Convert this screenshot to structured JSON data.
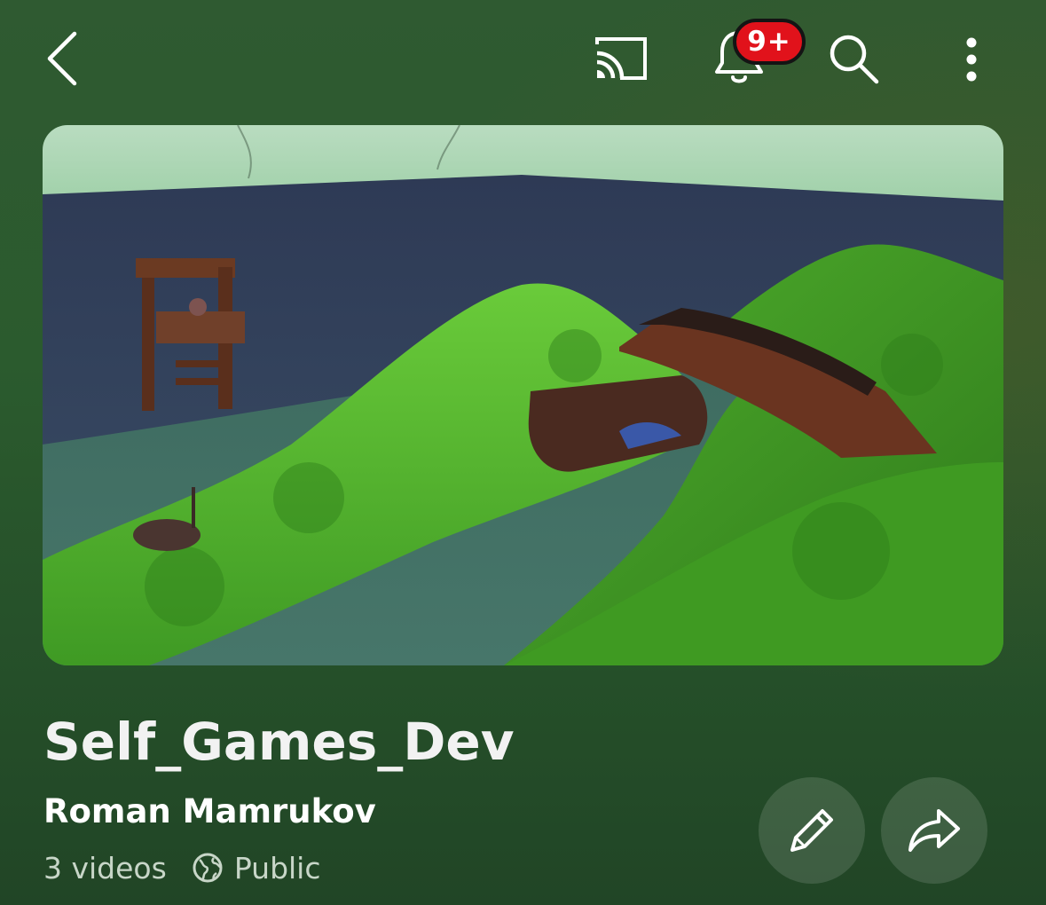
{
  "header": {
    "back_icon": "chevron-left-icon",
    "cast_icon": "cast-icon",
    "notifications_icon": "bell-icon",
    "notifications_badge": "9+",
    "search_icon": "search-icon",
    "more_icon": "more-vertical-icon"
  },
  "thumbnail": {
    "alt": "Playlist thumbnail: 3D low-poly game scene with green hills, water, a wooden tower, a bridge and a boat"
  },
  "playlist": {
    "title": "Self_Games_Dev",
    "owner": "Roman Mamrukov",
    "video_count": "3 videos",
    "visibility": "Public",
    "visibility_icon": "globe-icon"
  },
  "actions": {
    "edit_icon": "pencil-icon",
    "share_icon": "share-icon"
  },
  "colors": {
    "background": "#2b5b2e",
    "badge": "#e1121b",
    "button_fill": "rgba(255,255,255,0.13)"
  }
}
